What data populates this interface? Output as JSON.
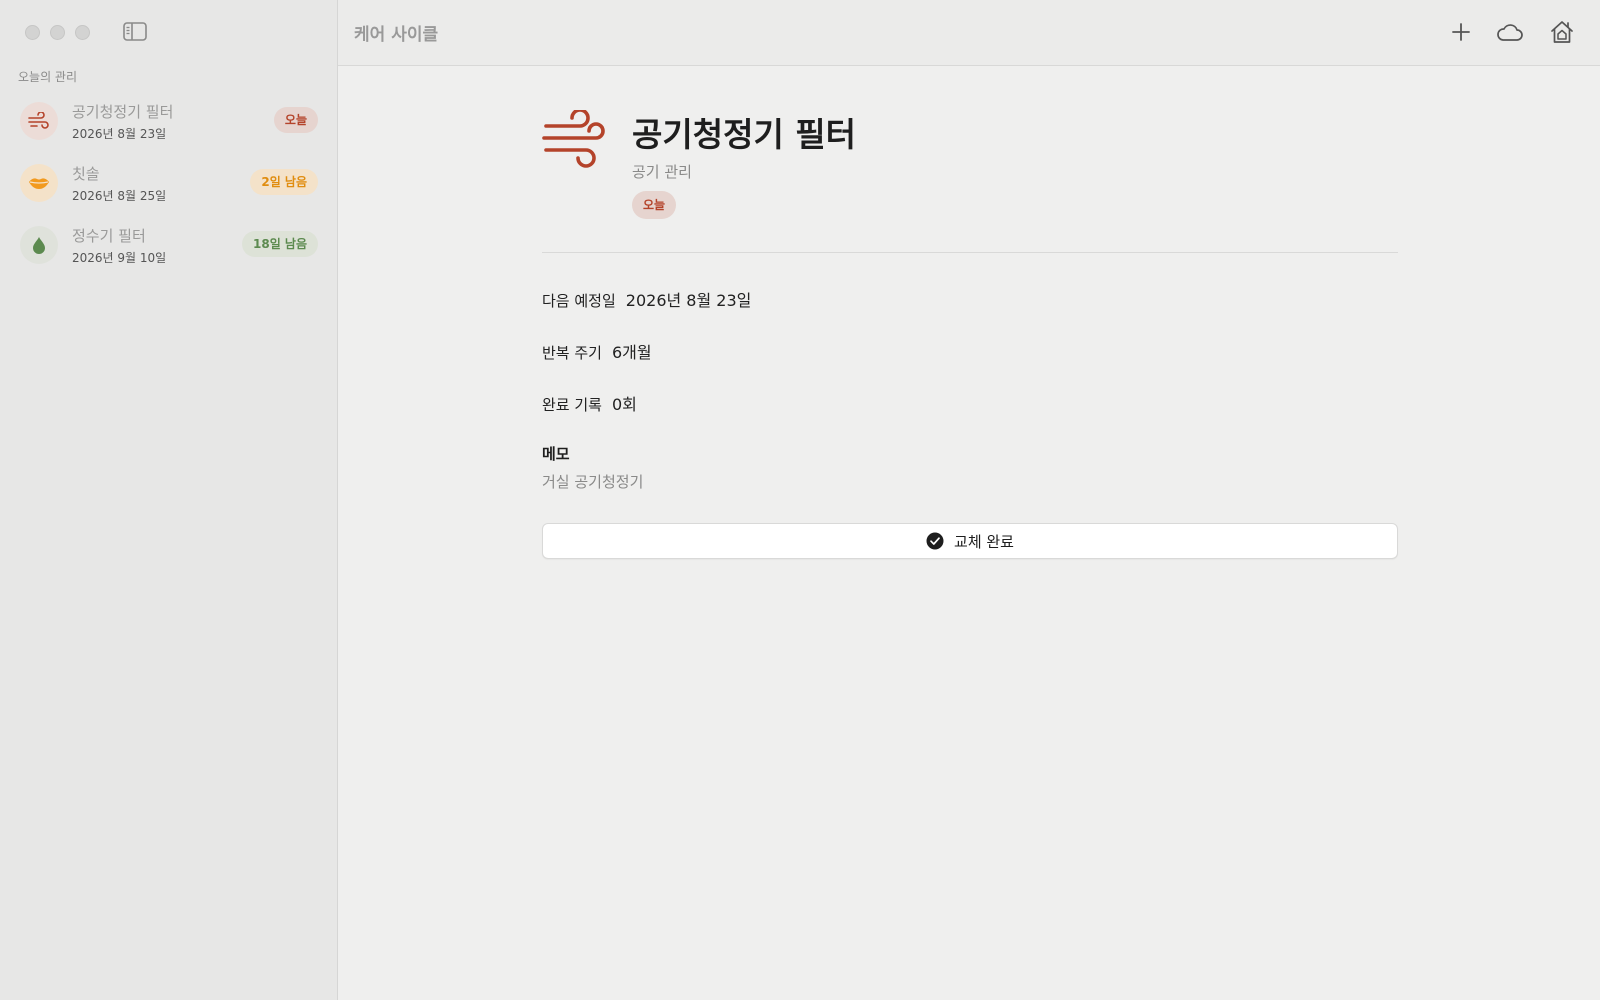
{
  "app": {
    "title": "케어 사이클"
  },
  "sidebar": {
    "section_label": "오늘의 관리",
    "items": [
      {
        "title": "공기청정기 필터",
        "date": "2026년 8월 23일",
        "badge": "오늘",
        "icon": "wind-icon",
        "icon_color": "#b4432a",
        "icon_bg": "#ecdcd7",
        "badge_color": "#b4432a",
        "badge_bg": "#e6d4cf"
      },
      {
        "title": "칫솔",
        "date": "2026년 8월 25일",
        "badge": "2일 남음",
        "icon": "lips-icon",
        "icon_color": "#f29a1f",
        "icon_bg": "#f4e2c9",
        "badge_color": "#e08d10",
        "badge_bg": "#f4e2c9"
      },
      {
        "title": "정수기 필터",
        "date": "2026년 9월 10일",
        "badge": "18일 남음",
        "icon": "drop-icon",
        "icon_color": "#5c8a4f",
        "icon_bg": "#dfe2db",
        "badge_color": "#5c8a4f",
        "badge_bg": "#dde2d7"
      }
    ]
  },
  "toolbar": {
    "add_icon": "plus-icon",
    "cloud_icon": "cloud-icon",
    "home_icon": "home-icon"
  },
  "detail": {
    "title": "공기청정기 필터",
    "category": "공기 관리",
    "badge": "오늘",
    "icon": "wind-icon",
    "fields": [
      {
        "key": "다음 예정일",
        "value": "2026년 8월 23일"
      },
      {
        "key": "반복 주기",
        "value": "6개월"
      },
      {
        "key": "완료 기록",
        "value": "0회"
      }
    ],
    "memo_label": "메모",
    "memo_value": "거실 공기청정기",
    "done_button_label": "교체 완료"
  }
}
